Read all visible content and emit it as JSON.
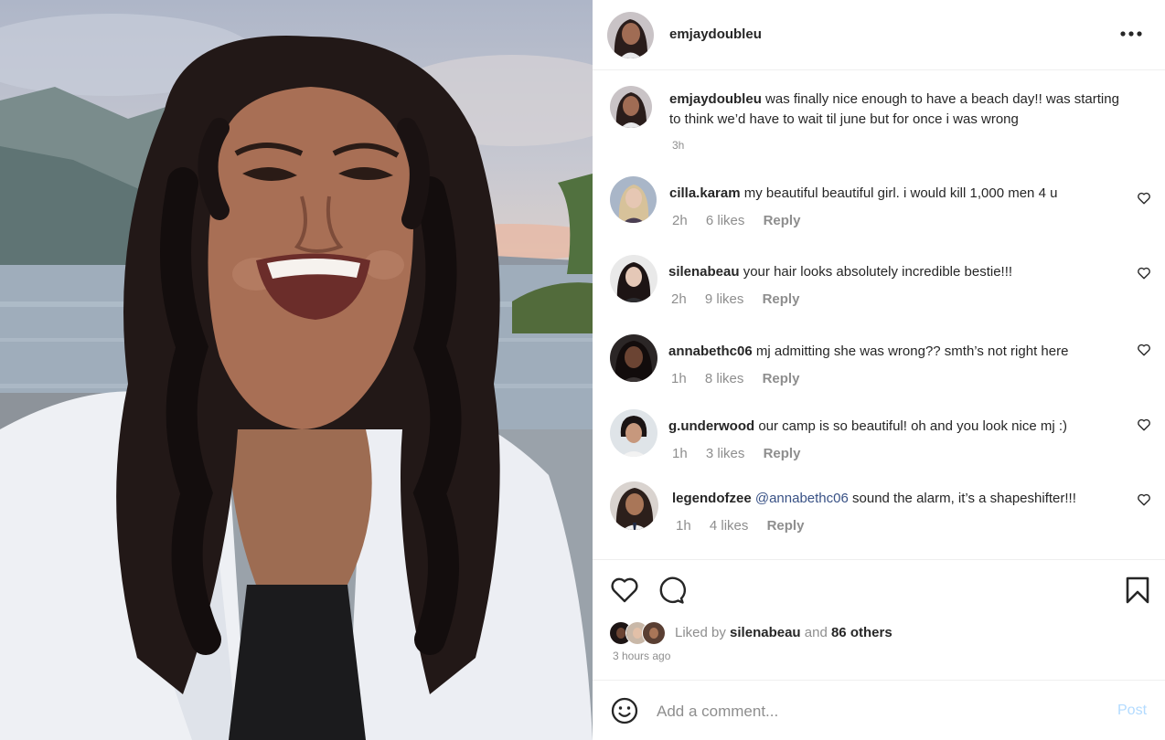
{
  "post": {
    "author": "emjaydoubleu",
    "caption": "was finally nice enough to have a beach day!! was starting to think we’d have to wait til june but for once i was wrong",
    "caption_time": "3h"
  },
  "comments": [
    {
      "user": "cilla.karam",
      "mention": "",
      "text": "my beautiful beautiful girl. i would kill 1,000 men 4 u",
      "time": "2h",
      "likes": "6 likes",
      "reply": "Reply"
    },
    {
      "user": "silenabeau",
      "mention": "",
      "text": "your hair looks absolutely incredible bestie!!!",
      "time": "2h",
      "likes": "9 likes",
      "reply": "Reply"
    },
    {
      "user": "annabethc06",
      "mention": "",
      "text": "mj admitting she was wrong?? smth’s not right here",
      "time": "1h",
      "likes": "8 likes",
      "reply": "Reply"
    },
    {
      "user": "g.underwood",
      "mention": "",
      "text": "our camp is so beautiful! oh and you look nice mj :)",
      "time": "1h",
      "likes": "3 likes",
      "reply": "Reply"
    },
    {
      "user": "legendofzee",
      "mention": "@annabethc06",
      "text": "sound the alarm, it’s a shapeshifter!!!",
      "time": "1h",
      "likes": "4 likes",
      "reply": "Reply"
    }
  ],
  "likes": {
    "prefix": "Liked by",
    "user": "silenabeau",
    "joiner": "and",
    "others": "86 others",
    "posted": "3 hours ago"
  },
  "add_comment": {
    "placeholder": "Add a comment...",
    "post_label": "Post"
  },
  "icons": {
    "more": "more-dots-icon",
    "like": "heart-icon",
    "comment": "speech-bubble-icon",
    "save": "bookmark-icon",
    "emoji": "emoji-smile-icon"
  },
  "colors": {
    "mention": "#385185",
    "post_disabled": "#b3dbff",
    "muted": "#8e8e8e"
  }
}
